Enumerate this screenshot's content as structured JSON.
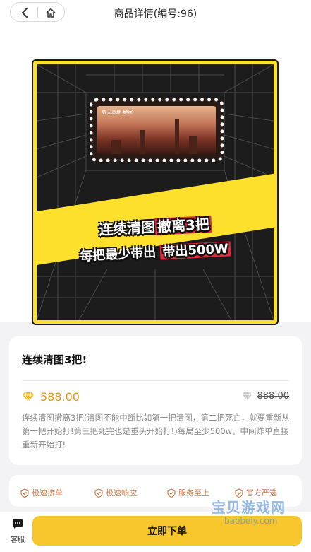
{
  "header": {
    "title": "商品详情(编号:96)",
    "back_icon": "chevron-left-icon",
    "home_icon": "home-icon"
  },
  "banner": {
    "screen_caption": "航天基地-绝密",
    "promo_line1_prefix": "连续清图",
    "promo_line1_highlight": "撤离3把",
    "promo_line2_prefix": "每把最少带出",
    "promo_line2_highlight": "带出500W",
    "accent_yellow": "#fde02b",
    "accent_red": "#e5283b"
  },
  "product": {
    "title": "连续清图3把!",
    "price": "588.00",
    "original_price": "888.00",
    "price_color": "#e39a16",
    "description": "连续清图撤离3把(清图不能中断比如第一把清图，第二把死亡，就要重新从第一把开始打!第三把死完也是重头开始打!)每局至少500w，中间炸单直接重新开始打!"
  },
  "services": [
    {
      "label": "极速接单",
      "icon": "shield-check-icon"
    },
    {
      "label": "极速响应",
      "icon": "shield-check-icon"
    },
    {
      "label": "服务至上",
      "icon": "shield-check-icon"
    },
    {
      "label": "官方严选",
      "icon": "shield-check-icon"
    }
  ],
  "bottom": {
    "customer_service_label": "客服",
    "customer_service_icon": "chat-icon",
    "order_button": "立即下单",
    "button_color": "#f7c62c"
  },
  "watermark": {
    "text": "宝贝游戏网",
    "url": "baobeiy.com"
  }
}
